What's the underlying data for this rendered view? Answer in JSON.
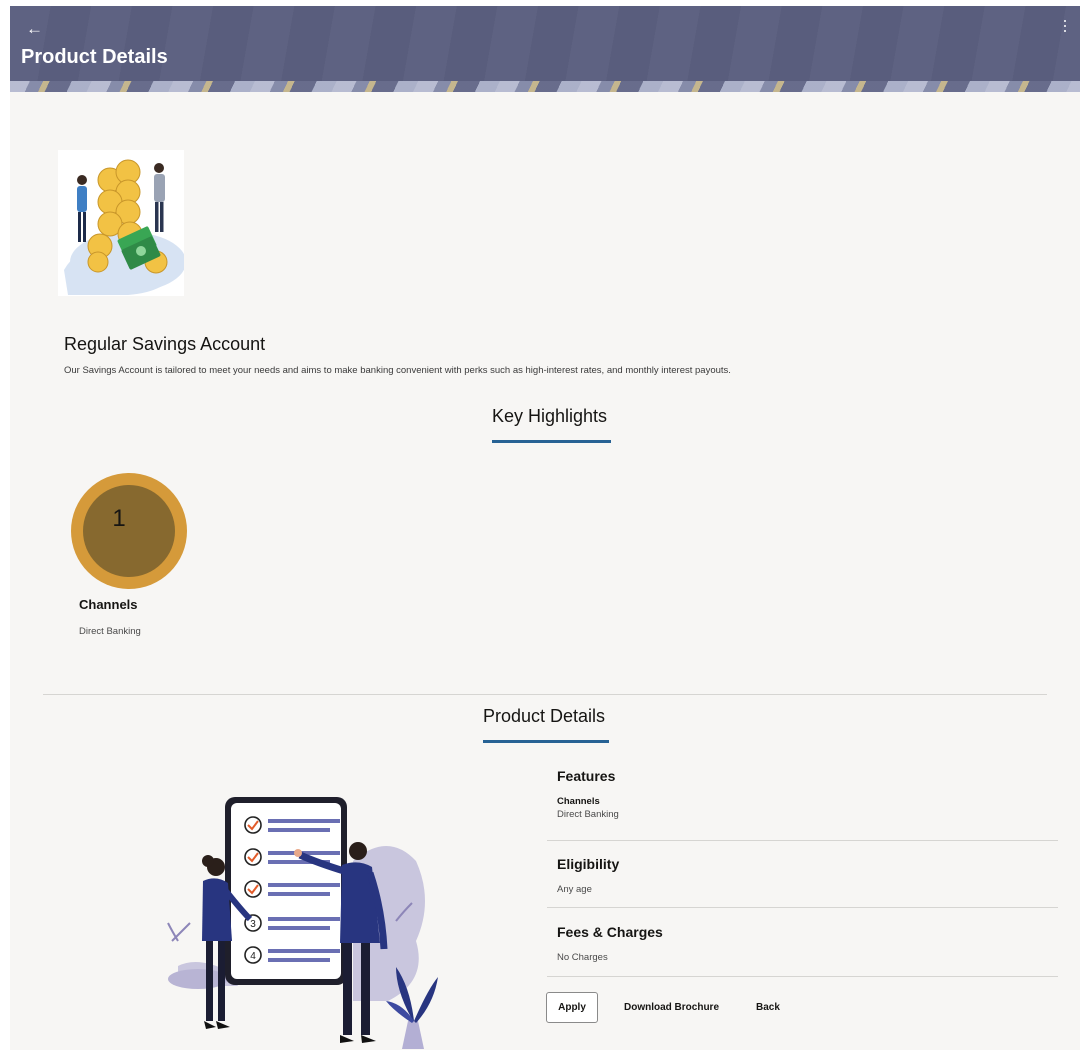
{
  "header": {
    "title": "Product Details",
    "back_icon": "arrow-left-icon",
    "menu_icon": "kebab-menu-icon"
  },
  "product": {
    "name": "Regular Savings Account",
    "description": "Our Savings Account is tailored to meet your needs and aims to make banking convenient with perks such as high-interest rates, and monthly interest payouts."
  },
  "key_highlights": {
    "title": "Key Highlights",
    "items": [
      {
        "number": "1",
        "title": "Channels",
        "value": "Direct Banking"
      }
    ]
  },
  "product_details": {
    "title": "Product Details",
    "features": {
      "heading": "Features",
      "sub_label": "Channels",
      "value": "Direct Banking"
    },
    "eligibility": {
      "heading": "Eligibility",
      "value": "Any age"
    },
    "fees": {
      "heading": "Fees & Charges",
      "value": "No Charges"
    }
  },
  "actions": {
    "apply": "Apply",
    "download": "Download Brochure",
    "back": "Back"
  },
  "colors": {
    "header_bg": "#5b5f7f",
    "accent_underline": "#276294",
    "highlight_outer": "#d59a3a",
    "highlight_inner": "#87692f",
    "page_bg": "#f7f6f4"
  }
}
